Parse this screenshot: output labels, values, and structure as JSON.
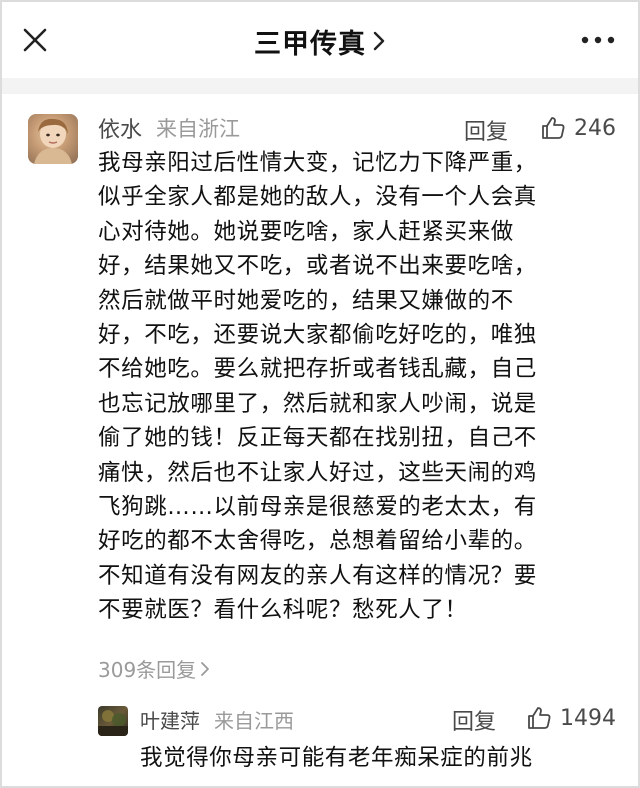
{
  "header": {
    "title": "三甲传真",
    "close_icon": "close-icon",
    "more_icon": "more-dots-icon"
  },
  "comment": {
    "username": "依水",
    "location": "来自浙江",
    "reply_label": "回复",
    "like_count": "246",
    "lines": [
      "我母亲阳过后性情大变，记忆力下降严重，",
      "似乎全家人都是她的敌人，没有一个人会真",
      "心对待她。她说要吃啥，家人赶紧买来做",
      "好，结果她又不吃，或者说不出来要吃啥，",
      "然后就做平时她爱吃的，结果又嫌做的不",
      "好，不吃，还要说大家都偷吃好吃的，唯独",
      "不给她吃。要么就把存折或者钱乱藏，自己",
      "也忘记放哪里了，然后就和家人吵闹，说是",
      "偷了她的钱！反正每天都在找别扭，自己不",
      "痛快，然后也不让家人好过，这些天闹的鸡",
      "飞狗跳……以前母亲是很慈爱的老太太，有",
      "好吃的都不太舍得吃，总想着留给小辈的。",
      "不知道有没有网友的亲人有这样的情况？要",
      "不要就医？看什么科呢？愁死人了！"
    ],
    "more_replies": "309条回复"
  },
  "reply": {
    "username": "叶建萍",
    "location": "来自江西",
    "reply_label": "回复",
    "like_count": "1494",
    "text": "我觉得你母亲可能有老年痴呆症的前兆"
  },
  "colors": {
    "text_primary": "#111111",
    "text_secondary": "#4a4a4a",
    "text_muted": "#9a9a9a",
    "divider": "#f3f3f3"
  }
}
